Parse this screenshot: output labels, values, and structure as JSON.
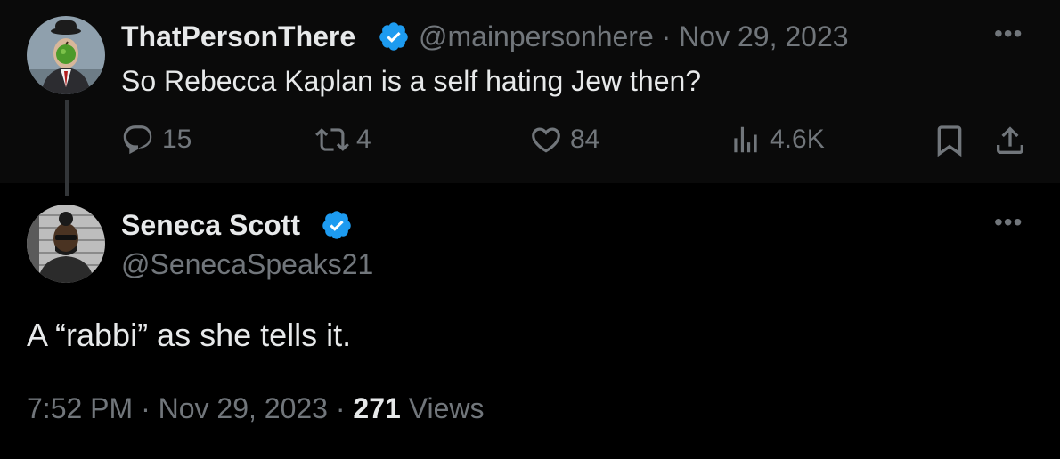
{
  "parent_tweet": {
    "display_name": "ThatPersonThere",
    "handle": "@mainpersonhere",
    "separator": "·",
    "date": "Nov 29, 2023",
    "text": "So Rebecca Kaplan is a self hating Jew then?",
    "more": "•••",
    "stats": {
      "replies": "15",
      "retweets": "4",
      "likes": "84",
      "views": "4.6K"
    }
  },
  "main_tweet": {
    "display_name": "Seneca Scott",
    "handle": "@SenecaSpeaks21",
    "more": "•••",
    "text": "A “rabbi” as she tells it.",
    "time": "7:52 PM",
    "sep1": "·",
    "date": "Nov 29, 2023",
    "sep2": "·",
    "views_count": "271",
    "views_label": "Views"
  },
  "colors": {
    "background": "#000000",
    "parent_background": "#0a0a0a",
    "text": "#e7e9ea",
    "muted": "#71767b",
    "verified": "#1d9bf0"
  },
  "icons": [
    "reply-icon",
    "retweet-icon",
    "like-icon",
    "views-icon",
    "bookmark-icon",
    "share-icon",
    "verified-badge-icon",
    "more-icon"
  ]
}
